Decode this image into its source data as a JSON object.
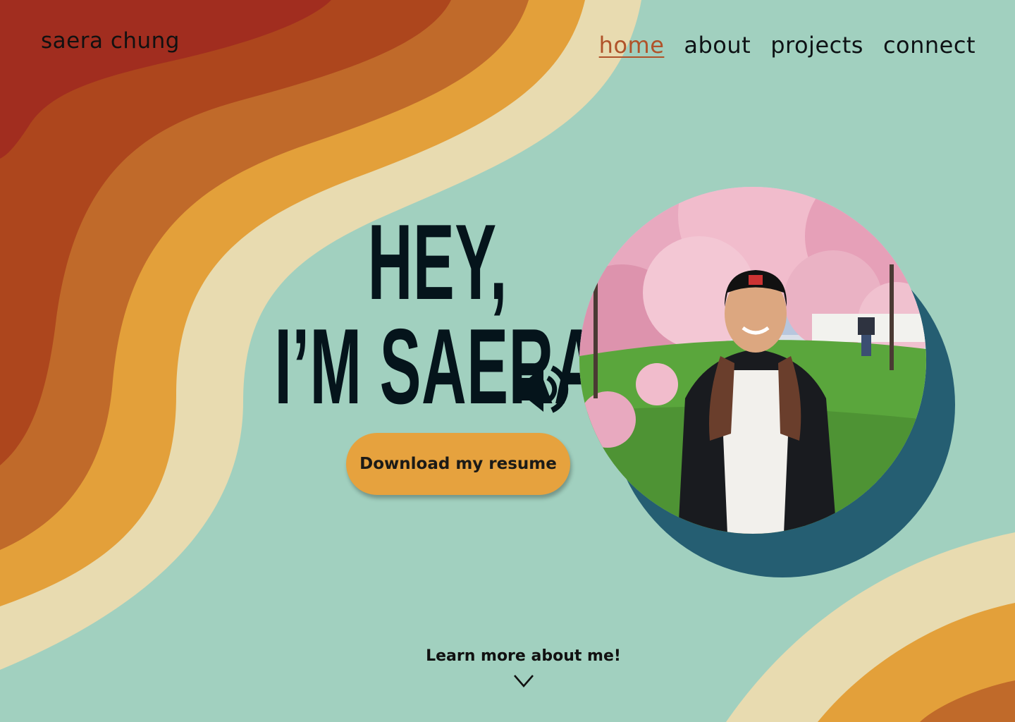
{
  "site": {
    "name": "saera chung"
  },
  "nav": {
    "items": [
      {
        "label": "home",
        "active": true
      },
      {
        "label": "about",
        "active": false
      },
      {
        "label": "projects",
        "active": false
      },
      {
        "label": "connect",
        "active": false
      }
    ]
  },
  "hero": {
    "line1": "HEY,",
    "line2": "I’M SAERA!",
    "speaker_icon": "speaker-volume-icon",
    "resume_button": "Download my resume"
  },
  "photo": {
    "subject": "profile-photo"
  },
  "footer": {
    "learn_more": "Learn more about me!",
    "arrow_icon": "chevron-down-icon"
  },
  "colors": {
    "background": "#a1d0bf",
    "wave_red": "#a12d1f",
    "wave_rust": "#ad461d",
    "wave_orange": "#c06a2a",
    "wave_gold": "#e3a03a",
    "wave_cream": "#e8dbb0",
    "accent_nav": "#b0532a",
    "button": "#e6a23e",
    "photo_shadow": "#255e72",
    "text": "#05141b"
  }
}
